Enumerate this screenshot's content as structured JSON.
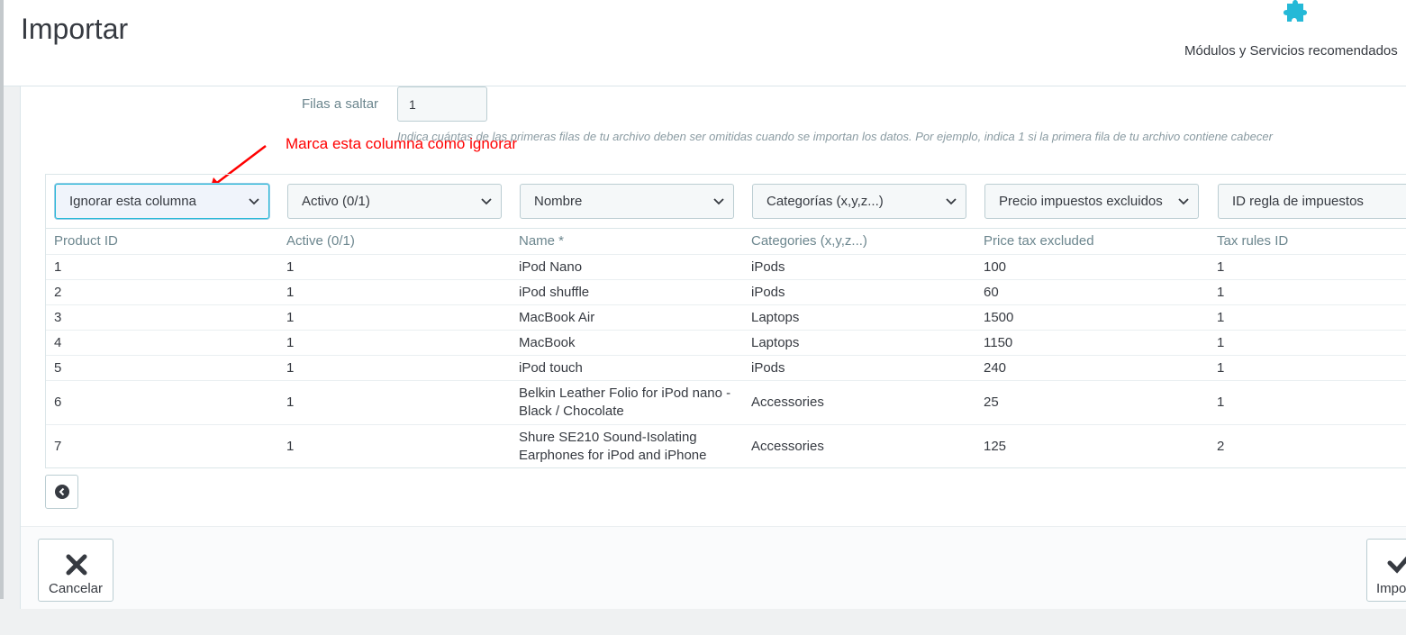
{
  "header": {
    "title": "Importar",
    "toolbar_label": "Módulos y Servicios recomendados"
  },
  "form": {
    "skip_label": "Filas a saltar",
    "skip_value": "1",
    "help_text": "Indica cuántas de las primeras filas de tu archivo deben ser omitidas cuando se importan los datos. Por ejemplo, indica 1 si la primera fila de tu archivo contiene cabecer",
    "annotation": "Marca esta columna como ignorar"
  },
  "column_selects": [
    "Ignorar esta columna",
    "Activo (0/1)",
    "Nombre",
    "Categorías (x,y,z...)",
    "Precio impuestos excluidos",
    "ID regla de impuestos"
  ],
  "table": {
    "headers": [
      "Product ID",
      "Active (0/1)",
      "Name *",
      "Categories (x,y,z...)",
      "Price tax excluded",
      "Tax rules ID"
    ],
    "rows": [
      [
        "1",
        "1",
        "iPod Nano",
        "iPods",
        "100",
        "1"
      ],
      [
        "2",
        "1",
        "iPod shuffle",
        "iPods",
        "60",
        "1"
      ],
      [
        "3",
        "1",
        "MacBook Air",
        "Laptops",
        "1500",
        "1"
      ],
      [
        "4",
        "1",
        "MacBook",
        "Laptops",
        "1150",
        "1"
      ],
      [
        "5",
        "1",
        "iPod touch",
        "iPods",
        "240",
        "1"
      ],
      [
        "6",
        "1",
        "Belkin Leather Folio for iPod nano - Black / Chocolate",
        "Accessories",
        "25",
        "1"
      ],
      [
        "7",
        "1",
        "Shure SE210 Sound-Isolating Earphones for iPod and iPhone",
        "Accessories",
        "125",
        "2"
      ]
    ]
  },
  "footer": {
    "cancel_label": "Cancelar",
    "import_label": "Impo"
  },
  "colors": {
    "accent": "#25b9d7",
    "annotation": "#ff0000"
  },
  "icons": {
    "toolbar": "puzzle-icon",
    "prev": "chevron-circle-left-icon",
    "cancel": "close-icon",
    "import": "check-icon"
  }
}
